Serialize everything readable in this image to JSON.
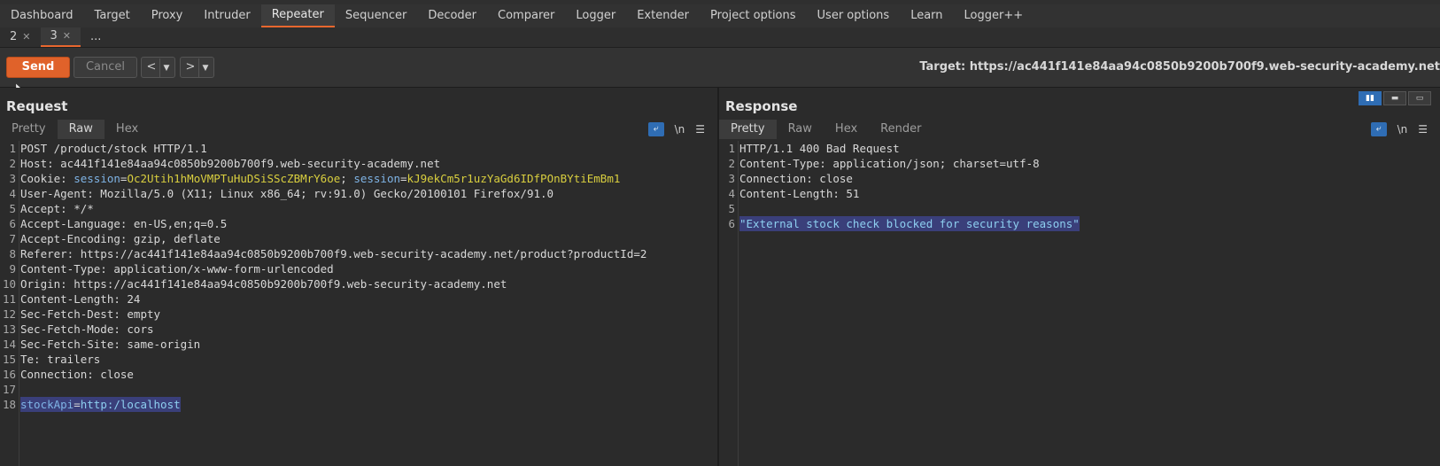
{
  "menu": [
    "Dashboard",
    "Target",
    "Proxy",
    "Intruder",
    "Repeater",
    "Sequencer",
    "Decoder",
    "Comparer",
    "Logger",
    "Extender",
    "Project options",
    "User options",
    "Learn",
    "Logger++"
  ],
  "repeater_tabs": [
    {
      "label": "2"
    },
    {
      "label": "3"
    },
    {
      "label": "..."
    }
  ],
  "toolbar": {
    "send_label": "Send",
    "cancel_label": "Cancel",
    "back_label": "<",
    "forward_label": ">",
    "target_text": "Target: https://ac441f141e84aa94c0850b9200b700f9.web-security-academy.net"
  },
  "request": {
    "title": "Request",
    "tabs": [
      "Pretty",
      "Raw",
      "Hex"
    ],
    "active_tab": "Raw",
    "lines": [
      {
        "n": "1",
        "text": "POST /product/stock HTTP/1.1"
      },
      {
        "n": "2",
        "text": "Host: ac441f141e84aa94c0850b9200b700f9.web-security-academy.net"
      },
      {
        "n": "3",
        "key": "Cookie:",
        "c1": "session",
        "v1": "Oc2Utih1hMoVMPTuHuDSiSScZBMrY6oe",
        "c2": "session",
        "v2": "kJ9ekCm5r1uzYaGd6IDfPOnBYtiEmBm1"
      },
      {
        "n": "4",
        "text": "User-Agent: Mozilla/5.0 (X11; Linux x86_64; rv:91.0) Gecko/20100101 Firefox/91.0"
      },
      {
        "n": "5",
        "text": "Accept: */*"
      },
      {
        "n": "6",
        "text": "Accept-Language: en-US,en;q=0.5"
      },
      {
        "n": "7",
        "text": "Accept-Encoding: gzip, deflate"
      },
      {
        "n": "8",
        "text": "Referer: https://ac441f141e84aa94c0850b9200b700f9.web-security-academy.net/product?productId=2"
      },
      {
        "n": "9",
        "text": "Content-Type: application/x-www-form-urlencoded"
      },
      {
        "n": "10",
        "text": "Origin: https://ac441f141e84aa94c0850b9200b700f9.web-security-academy.net"
      },
      {
        "n": "11",
        "text": "Content-Length: 24"
      },
      {
        "n": "12",
        "text": "Sec-Fetch-Dest: empty"
      },
      {
        "n": "13",
        "text": "Sec-Fetch-Mode: cors"
      },
      {
        "n": "14",
        "text": "Sec-Fetch-Site: same-origin"
      },
      {
        "n": "15",
        "text": "Te: trailers"
      },
      {
        "n": "16",
        "text": "Connection: close"
      },
      {
        "n": "17",
        "text": ""
      },
      {
        "n": "18",
        "body_key": "stockApi",
        "body_val": "http:/localhost"
      }
    ]
  },
  "response": {
    "title": "Response",
    "tabs": [
      "Pretty",
      "Raw",
      "Hex",
      "Render"
    ],
    "active_tab": "Pretty",
    "lines": [
      {
        "n": "1",
        "text": "HTTP/1.1 400 Bad Request"
      },
      {
        "n": "2",
        "text": "Content-Type: application/json; charset=utf-8"
      },
      {
        "n": "3",
        "text": "Connection: close"
      },
      {
        "n": "4",
        "text": "Content-Length: 51"
      },
      {
        "n": "5",
        "text": ""
      },
      {
        "n": "6",
        "body": "\"External stock check blocked for security reasons\""
      }
    ]
  },
  "colors": {
    "accent": "#e8672e",
    "selection": "#3a3f7a",
    "tool_active": "#2f6db4"
  }
}
